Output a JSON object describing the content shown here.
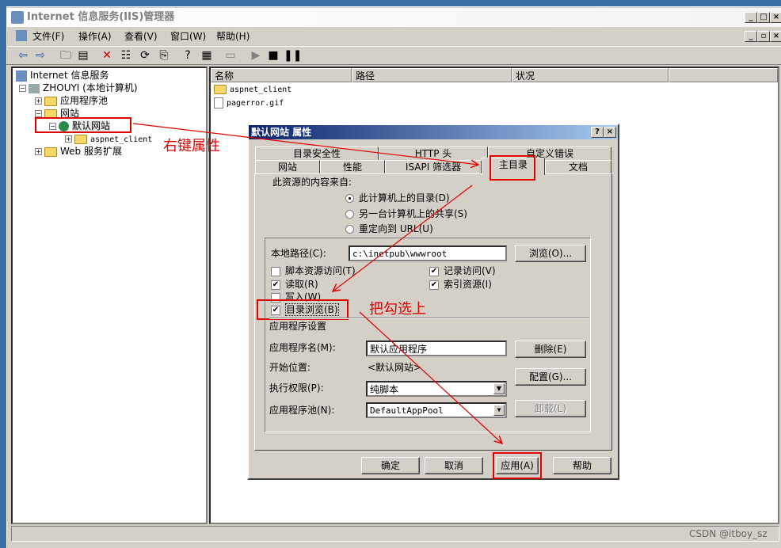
{
  "window": {
    "title": "Internet 信息服务(IIS)管理器"
  },
  "menu": [
    "文件(F)",
    "操作(A)",
    "查看(V)",
    "窗口(W)",
    "帮助(H)"
  ],
  "tree": {
    "root": "Internet 信息服务",
    "computer": "ZHOUYI (本地计算机)",
    "app_pools": "应用程序池",
    "websites": "网站",
    "default_site": "默认网站",
    "aspnet_client": "aspnet_client",
    "web_ext": "Web 服务扩展"
  },
  "list": {
    "columns": [
      "名称",
      "路径",
      "状况"
    ],
    "rows": [
      "aspnet_client",
      "pagerror.gif"
    ]
  },
  "dialog": {
    "title": "默认网站 属性",
    "tabs_row1": [
      "目录安全性",
      "HTTP 头",
      "自定义错误"
    ],
    "tabs_row2": [
      "网站",
      "性能",
      "ISAPI 筛选器",
      "主目录",
      "文档"
    ],
    "content_source": "此资源的内容来自:",
    "radios": [
      "此计算机上的目录(D)",
      "另一台计算机上的共享(S)",
      "重定向到 URL(U)"
    ],
    "local_path_label": "本地路径(C):",
    "local_path_value": "c:\\inetpub\\wwwroot",
    "browse": "浏览(O)...",
    "checks_left": [
      "脚本资源访问(T)",
      "读取(R)",
      "写入(W)",
      "目录浏览(B)"
    ],
    "checks_right": [
      "记录访问(V)",
      "索引资源(I)"
    ],
    "app_settings": "应用程序设置",
    "app_name_label": "应用程序名(M):",
    "app_name_value": "默认应用程序",
    "remove": "删除(E)",
    "start_label": "开始位置:",
    "start_value": "<默认网站>",
    "config": "配置(G)...",
    "exec_label": "执行权限(P):",
    "exec_value": "纯脚本",
    "pool_label": "应用程序池(N):",
    "pool_value": "DefaultAppPool",
    "unload": "卸载(L)",
    "ok": "确定",
    "cancel": "取消",
    "apply": "应用(A)",
    "help": "帮助"
  },
  "annotations": {
    "right_click": "右键属性",
    "check_it": "把勾选上"
  },
  "watermark": "CSDN @itboy_sz"
}
